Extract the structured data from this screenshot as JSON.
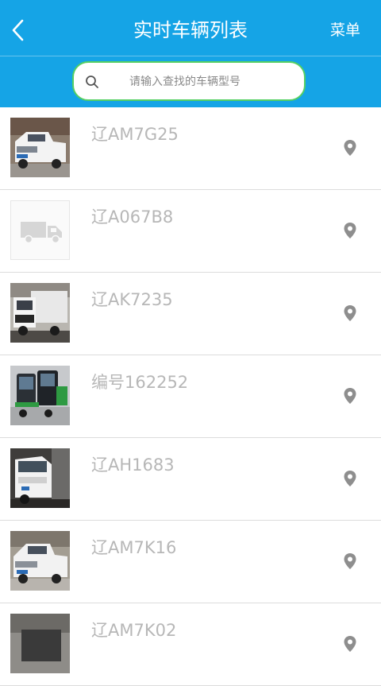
{
  "header": {
    "title": "实时车辆列表",
    "menu_label": "菜单",
    "color": "#15a4e6"
  },
  "search": {
    "placeholder": "请输入查找的车辆型号",
    "value": "",
    "border_color": "#54cf63"
  },
  "vehicles": [
    {
      "plate": "辽AM7G25",
      "image": "pickup-truck-photo"
    },
    {
      "plate": "辽A067B8",
      "image": "truck-placeholder-icon"
    },
    {
      "plate": "辽AK7235",
      "image": "dump-truck-photo"
    },
    {
      "plate": "编号162252",
      "image": "street-sweeper-photo"
    },
    {
      "plate": "辽AH1683",
      "image": "sanitation-truck-photo"
    },
    {
      "plate": "辽AM7K16",
      "image": "pickup-truck-photo"
    },
    {
      "plate": "辽AM7K02",
      "image": "vehicle-photo"
    }
  ]
}
